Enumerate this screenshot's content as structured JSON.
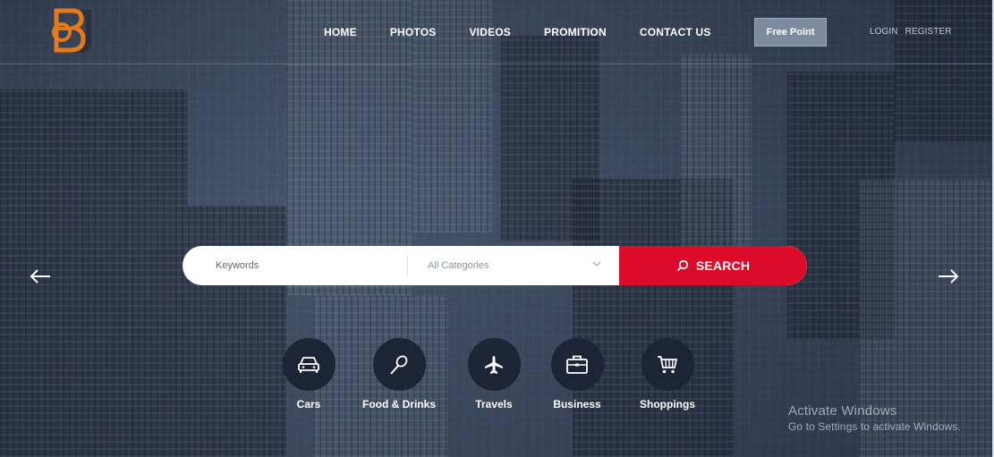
{
  "brand": {
    "logo_letters": "BU",
    "accent": "#e57a1b"
  },
  "nav": {
    "items": [
      "HOME",
      "PHOTOS",
      "VIDEOS",
      "PROMITION",
      "CONTACT US"
    ],
    "free_point": "Free Point",
    "login": "LOGIN",
    "register": "REGISTER"
  },
  "search": {
    "keywords_placeholder": "Keywords",
    "category_selected": "All Categories",
    "button_label": "SEARCH",
    "button_color": "#dd0b2a"
  },
  "categories": [
    {
      "label": "Cars",
      "icon": "car-icon"
    },
    {
      "label": "Food & Drinks",
      "icon": "food-icon"
    },
    {
      "label": "Travels",
      "icon": "plane-icon"
    },
    {
      "label": "Business",
      "icon": "briefcase-icon"
    },
    {
      "label": "Shoppings",
      "icon": "cart-icon"
    }
  ],
  "watermark": {
    "title": "Activate Windows",
    "subtitle": "Go to Settings to activate Windows."
  }
}
